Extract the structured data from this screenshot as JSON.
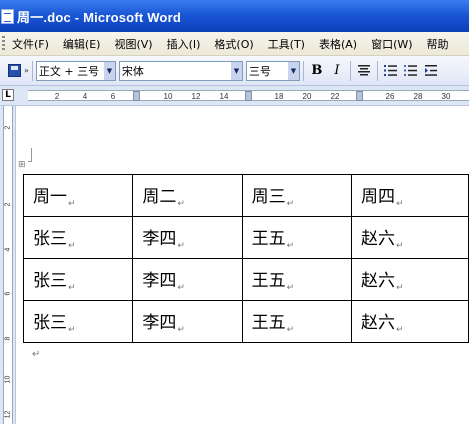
{
  "window": {
    "title": "周一.doc - Microsoft Word"
  },
  "menu": [
    "文件(F)",
    "编辑(E)",
    "视图(V)",
    "插入(I)",
    "格式(O)",
    "工具(T)",
    "表格(A)",
    "窗口(W)",
    "帮助"
  ],
  "toolbar": {
    "style_value": "正文 + 三号",
    "font_value": "宋体",
    "size_value": "三号",
    "bold_label": "B",
    "italic_label": "I"
  },
  "ruler": {
    "corner_label": "L",
    "numbers": [
      "2",
      "4",
      "6",
      "10",
      "12",
      "14",
      "18",
      "20",
      "22",
      "26",
      "28",
      "30"
    ],
    "vertical_numbers": [
      "2",
      "2",
      "4",
      "6",
      "8",
      "10",
      "12"
    ]
  },
  "table": {
    "rows": [
      [
        "周一",
        "周二",
        "周三",
        "周四"
      ],
      [
        "张三",
        "李四",
        "王五",
        "赵六"
      ],
      [
        "张三",
        "李四",
        "王五",
        "赵六"
      ],
      [
        "张三",
        "李四",
        "王五",
        "赵六"
      ]
    ]
  },
  "marks": {
    "cell_end": "↵",
    "paragraph_end": "↵",
    "table_anchor": "⊞"
  }
}
